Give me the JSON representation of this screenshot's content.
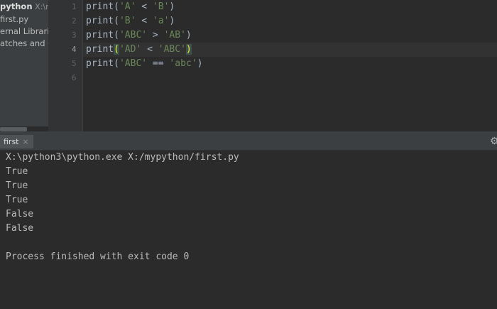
{
  "project_tree": {
    "root_name": "python",
    "root_path": "X:\\my",
    "items": [
      "first.py",
      "ernal Libraries",
      "atches and Co"
    ]
  },
  "editor": {
    "line_numbers": [
      "1",
      "2",
      "3",
      "4",
      "5",
      "6"
    ],
    "active_line": 4,
    "lines": [
      {
        "fn": "print(",
        "a": "'A'",
        "op": " < ",
        "b": "'B'",
        "end": ")"
      },
      {
        "fn": "print(",
        "a": "'B'",
        "op": " < ",
        "b": "'a'",
        "end": ")"
      },
      {
        "fn": "print(",
        "a": "'ABC'",
        "op": " > ",
        "b": "'AB'",
        "end": ")"
      },
      {
        "fn": "print",
        "paren": "(",
        "a": "'AD'",
        "op": " < ",
        "b": "'ABC'",
        "end": ")"
      },
      {
        "fn": "print(",
        "a": "'ABC'",
        "op": " == ",
        "b": "'abc'",
        "end": ")"
      }
    ]
  },
  "run_window": {
    "tab_label": "first",
    "close_glyph": "×",
    "settings_icon": "gear-icon",
    "output": [
      "X:\\python3\\python.exe X:/mypython/first.py",
      "True",
      "True",
      "True",
      "False",
      "False",
      "",
      "Process finished with exit code 0"
    ]
  }
}
